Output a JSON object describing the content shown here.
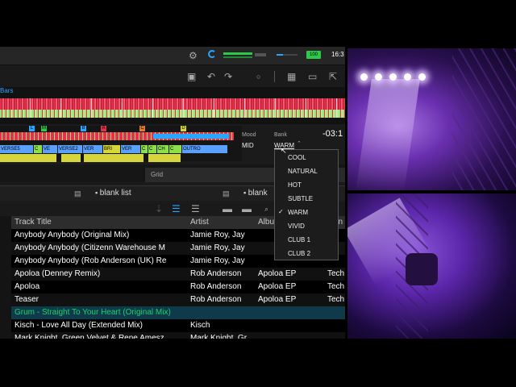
{
  "header": {
    "clock": "16:3",
    "battery_label": "100"
  },
  "waveform": {
    "label": "Bars"
  },
  "deck": {
    "time": "-03:1",
    "mood_label": "Mood",
    "mood_value": "MID",
    "bank_label": "Bank",
    "bank_value": "WARM",
    "hot_cues": [
      "L",
      "M",
      "B",
      "A",
      "C",
      "D"
    ],
    "phrases": [
      "VERSE5",
      "C",
      "VE",
      "VERSE2",
      "VER",
      "BRI",
      "VER",
      "C",
      "CH",
      "C",
      "OUTRO"
    ],
    "grid_label": "Grid"
  },
  "bank_dropdown": {
    "options": [
      "COOL",
      "NATURAL",
      "HOT",
      "SUBTLE",
      "WARM",
      "VIVID",
      "CLUB 1",
      "CLUB 2"
    ],
    "selected": "WARM"
  },
  "playlists": {
    "left_tab": "blank list",
    "right_tab": "blank"
  },
  "track_table": {
    "columns": [
      "Track Title",
      "Artist",
      "Albu",
      "en"
    ],
    "rows": [
      {
        "title": "Anybody Anybody (Original Mix)",
        "artist": "Jamie Roy, Jay",
        "album": "",
        "genre": ""
      },
      {
        "title": "Anybody Anybody (Citizenn Warehouse M",
        "artist": "Jamie Roy, Jay",
        "album": "",
        "genre": ""
      },
      {
        "title": "Anybody Anybody (Rob Anderson (UK) Re",
        "artist": "Jamie Roy, Jay",
        "album": "",
        "genre": ""
      },
      {
        "title": "Apoloa (Denney Remix)",
        "artist": "Rob Anderson",
        "album": "Apoloa EP",
        "genre": "Tech"
      },
      {
        "title": "Apoloa",
        "artist": "Rob Anderson",
        "album": "Apoloa EP",
        "genre": "Tech"
      },
      {
        "title": "Teaser",
        "artist": "Rob Anderson",
        "album": "Apoloa EP",
        "genre": "Tech"
      },
      {
        "title": "Grum - Straight To Your Heart (Original Mix)",
        "artist": "",
        "album": "",
        "genre": ""
      },
      {
        "title": "Kisch - Love All Day (Extended Mix)",
        "artist": "Kisch",
        "album": "",
        "genre": ""
      },
      {
        "title": "Mark Knight, Green Velvet & Rene Amesz",
        "artist": "Mark Knight, Gr",
        "album": "",
        "genre": ""
      }
    ],
    "highlight_row_color": "#1aa35a"
  },
  "colors": {
    "accent_blue": "#2aa6ff",
    "waveform_red": "#e0324b",
    "waveform_green": "#9fe07a",
    "cue_yellow": "#d6d63a"
  }
}
